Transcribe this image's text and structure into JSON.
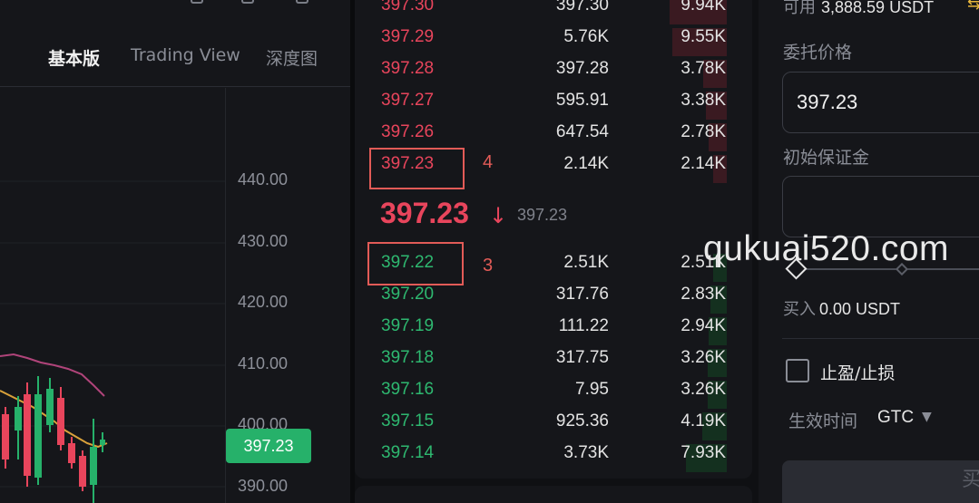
{
  "chart": {
    "tabs": [
      {
        "label": "基本版",
        "active": true
      },
      {
        "label": "Trading View",
        "active": false
      },
      {
        "label": "深度图",
        "active": false
      }
    ],
    "price_ticks": [
      "440.00",
      "430.00",
      "420.00",
      "410.00",
      "400.00",
      "390.00"
    ],
    "last_price_tag": "397.23",
    "colors": {
      "up": "#26b16a",
      "down": "#e8455c",
      "ma_pink": "#b0447a",
      "ma_orange": "#d9a13a"
    }
  },
  "orderbook": {
    "asks": [
      {
        "price": "397.30",
        "qty": "397.30",
        "total": "9.94K",
        "depth": 0.42
      },
      {
        "price": "397.29",
        "qty": "5.76K",
        "total": "9.55K",
        "depth": 0.4
      },
      {
        "price": "397.28",
        "qty": "397.28",
        "total": "3.78K",
        "depth": 0.17
      },
      {
        "price": "397.27",
        "qty": "595.91",
        "total": "3.38K",
        "depth": 0.15
      },
      {
        "price": "397.26",
        "qty": "647.54",
        "total": "2.78K",
        "depth": 0.13
      },
      {
        "price": "397.23",
        "qty": "2.14K",
        "total": "2.14K",
        "depth": 0.1
      }
    ],
    "mid_price": "397.23",
    "mid_arrow": "↓",
    "mark_price": "397.23",
    "bids": [
      {
        "price": "397.22",
        "qty": "2.51K",
        "total": "2.51K",
        "depth": 0.1
      },
      {
        "price": "397.20",
        "qty": "317.76",
        "total": "2.83K",
        "depth": 0.12
      },
      {
        "price": "397.19",
        "qty": "111.22",
        "total": "2.94K",
        "depth": 0.13
      },
      {
        "price": "397.18",
        "qty": "317.75",
        "total": "3.26K",
        "depth": 0.14
      },
      {
        "price": "397.16",
        "qty": "7.95",
        "total": "3.26K",
        "depth": 0.14
      },
      {
        "price": "397.15",
        "qty": "925.36",
        "total": "4.19K",
        "depth": 0.18
      },
      {
        "price": "397.14",
        "qty": "3.73K",
        "total": "7.93K",
        "depth": 0.3
      }
    ],
    "annotations": {
      "ask_marker": "4",
      "bid_marker": "3"
    }
  },
  "order_form": {
    "available_label": "可用",
    "available_value": "3,888.59 USDT",
    "price_label": "委托价格",
    "price_value": "397.23",
    "margin_label": "初始保证金",
    "margin_value": "",
    "buy_label": "买入",
    "buy_value": "0.00 USDT",
    "tpsl_label": "止盈/止损",
    "tif_label": "生效时间",
    "tif_value": "GTC",
    "submit_label": "买"
  },
  "watermark": "qukuai520.com"
}
